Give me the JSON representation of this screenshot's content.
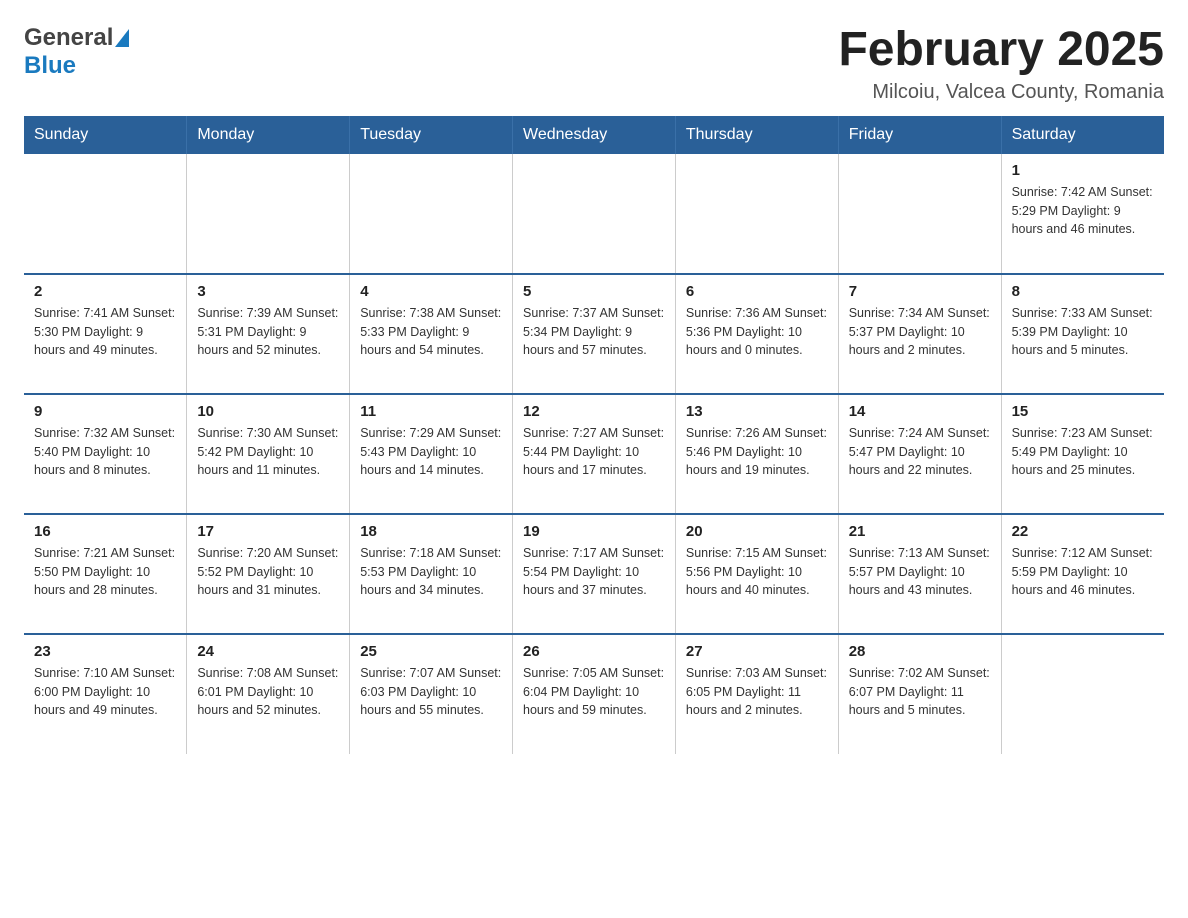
{
  "header": {
    "logo_general": "General",
    "logo_blue": "Blue",
    "month_title": "February 2025",
    "location": "Milcoiu, Valcea County, Romania"
  },
  "days_of_week": [
    "Sunday",
    "Monday",
    "Tuesday",
    "Wednesday",
    "Thursday",
    "Friday",
    "Saturday"
  ],
  "weeks": [
    [
      {
        "day": "",
        "info": ""
      },
      {
        "day": "",
        "info": ""
      },
      {
        "day": "",
        "info": ""
      },
      {
        "day": "",
        "info": ""
      },
      {
        "day": "",
        "info": ""
      },
      {
        "day": "",
        "info": ""
      },
      {
        "day": "1",
        "info": "Sunrise: 7:42 AM\nSunset: 5:29 PM\nDaylight: 9 hours and 46 minutes."
      }
    ],
    [
      {
        "day": "2",
        "info": "Sunrise: 7:41 AM\nSunset: 5:30 PM\nDaylight: 9 hours and 49 minutes."
      },
      {
        "day": "3",
        "info": "Sunrise: 7:39 AM\nSunset: 5:31 PM\nDaylight: 9 hours and 52 minutes."
      },
      {
        "day": "4",
        "info": "Sunrise: 7:38 AM\nSunset: 5:33 PM\nDaylight: 9 hours and 54 minutes."
      },
      {
        "day": "5",
        "info": "Sunrise: 7:37 AM\nSunset: 5:34 PM\nDaylight: 9 hours and 57 minutes."
      },
      {
        "day": "6",
        "info": "Sunrise: 7:36 AM\nSunset: 5:36 PM\nDaylight: 10 hours and 0 minutes."
      },
      {
        "day": "7",
        "info": "Sunrise: 7:34 AM\nSunset: 5:37 PM\nDaylight: 10 hours and 2 minutes."
      },
      {
        "day": "8",
        "info": "Sunrise: 7:33 AM\nSunset: 5:39 PM\nDaylight: 10 hours and 5 minutes."
      }
    ],
    [
      {
        "day": "9",
        "info": "Sunrise: 7:32 AM\nSunset: 5:40 PM\nDaylight: 10 hours and 8 minutes."
      },
      {
        "day": "10",
        "info": "Sunrise: 7:30 AM\nSunset: 5:42 PM\nDaylight: 10 hours and 11 minutes."
      },
      {
        "day": "11",
        "info": "Sunrise: 7:29 AM\nSunset: 5:43 PM\nDaylight: 10 hours and 14 minutes."
      },
      {
        "day": "12",
        "info": "Sunrise: 7:27 AM\nSunset: 5:44 PM\nDaylight: 10 hours and 17 minutes."
      },
      {
        "day": "13",
        "info": "Sunrise: 7:26 AM\nSunset: 5:46 PM\nDaylight: 10 hours and 19 minutes."
      },
      {
        "day": "14",
        "info": "Sunrise: 7:24 AM\nSunset: 5:47 PM\nDaylight: 10 hours and 22 minutes."
      },
      {
        "day": "15",
        "info": "Sunrise: 7:23 AM\nSunset: 5:49 PM\nDaylight: 10 hours and 25 minutes."
      }
    ],
    [
      {
        "day": "16",
        "info": "Sunrise: 7:21 AM\nSunset: 5:50 PM\nDaylight: 10 hours and 28 minutes."
      },
      {
        "day": "17",
        "info": "Sunrise: 7:20 AM\nSunset: 5:52 PM\nDaylight: 10 hours and 31 minutes."
      },
      {
        "day": "18",
        "info": "Sunrise: 7:18 AM\nSunset: 5:53 PM\nDaylight: 10 hours and 34 minutes."
      },
      {
        "day": "19",
        "info": "Sunrise: 7:17 AM\nSunset: 5:54 PM\nDaylight: 10 hours and 37 minutes."
      },
      {
        "day": "20",
        "info": "Sunrise: 7:15 AM\nSunset: 5:56 PM\nDaylight: 10 hours and 40 minutes."
      },
      {
        "day": "21",
        "info": "Sunrise: 7:13 AM\nSunset: 5:57 PM\nDaylight: 10 hours and 43 minutes."
      },
      {
        "day": "22",
        "info": "Sunrise: 7:12 AM\nSunset: 5:59 PM\nDaylight: 10 hours and 46 minutes."
      }
    ],
    [
      {
        "day": "23",
        "info": "Sunrise: 7:10 AM\nSunset: 6:00 PM\nDaylight: 10 hours and 49 minutes."
      },
      {
        "day": "24",
        "info": "Sunrise: 7:08 AM\nSunset: 6:01 PM\nDaylight: 10 hours and 52 minutes."
      },
      {
        "day": "25",
        "info": "Sunrise: 7:07 AM\nSunset: 6:03 PM\nDaylight: 10 hours and 55 minutes."
      },
      {
        "day": "26",
        "info": "Sunrise: 7:05 AM\nSunset: 6:04 PM\nDaylight: 10 hours and 59 minutes."
      },
      {
        "day": "27",
        "info": "Sunrise: 7:03 AM\nSunset: 6:05 PM\nDaylight: 11 hours and 2 minutes."
      },
      {
        "day": "28",
        "info": "Sunrise: 7:02 AM\nSunset: 6:07 PM\nDaylight: 11 hours and 5 minutes."
      },
      {
        "day": "",
        "info": ""
      }
    ]
  ]
}
